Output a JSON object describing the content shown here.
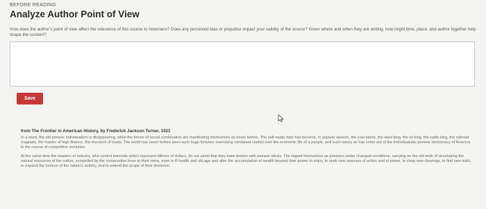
{
  "header": {
    "kicker": "BEFORE READING",
    "title": "Analyze Author Point of View"
  },
  "prompt": {
    "text": "How does the author's point of view affect the relevance of this source to historians? Does any perceived bias or prejudice impact your validity of the source? Given where and when they are writing, how might time, place, and author together help shape the content?"
  },
  "answer": {
    "value": "",
    "placeholder": ""
  },
  "actions": {
    "save_label": "Save"
  },
  "source": {
    "heading": "from The Frontier in American History, by Frederick Jackson Turner, 1921",
    "paragraphs": [
      "In a word, the old pioneer individualism is disappearing, while the forces of social combination are manifesting themselves as never before. The self-made man has become, in popular speech, the coal baron, the steel king, the oil king, the cattle king, the railroad magnate, the master of high finance, the monarch of trusts. The world has never before seen such huge fortunes exercising combined control over the economic life of a people, and such luxury as has come out of the individualistic pioneer democracy of America in the course of competitive evolution.",
      "At the same time the masters of industry, who control interests which represent billions of dollars, do not admit that they have broken with pioneer ideals. The regard themselves as pioneers under changed conditions, carrying on the old work of developing the natural resources of the nation, compelled by the constructive fever in their veins, even in ill health and old age and after the accumulation of wealth beyond their power to enjoy, to seek new avenues of action and of power, to chop new clearings, to find new trails, to expand the horizon of the nation's activity, and to extend the scope of their dominion."
    ]
  },
  "colors": {
    "accent": "#c63836",
    "background": "#f4f4f2"
  }
}
